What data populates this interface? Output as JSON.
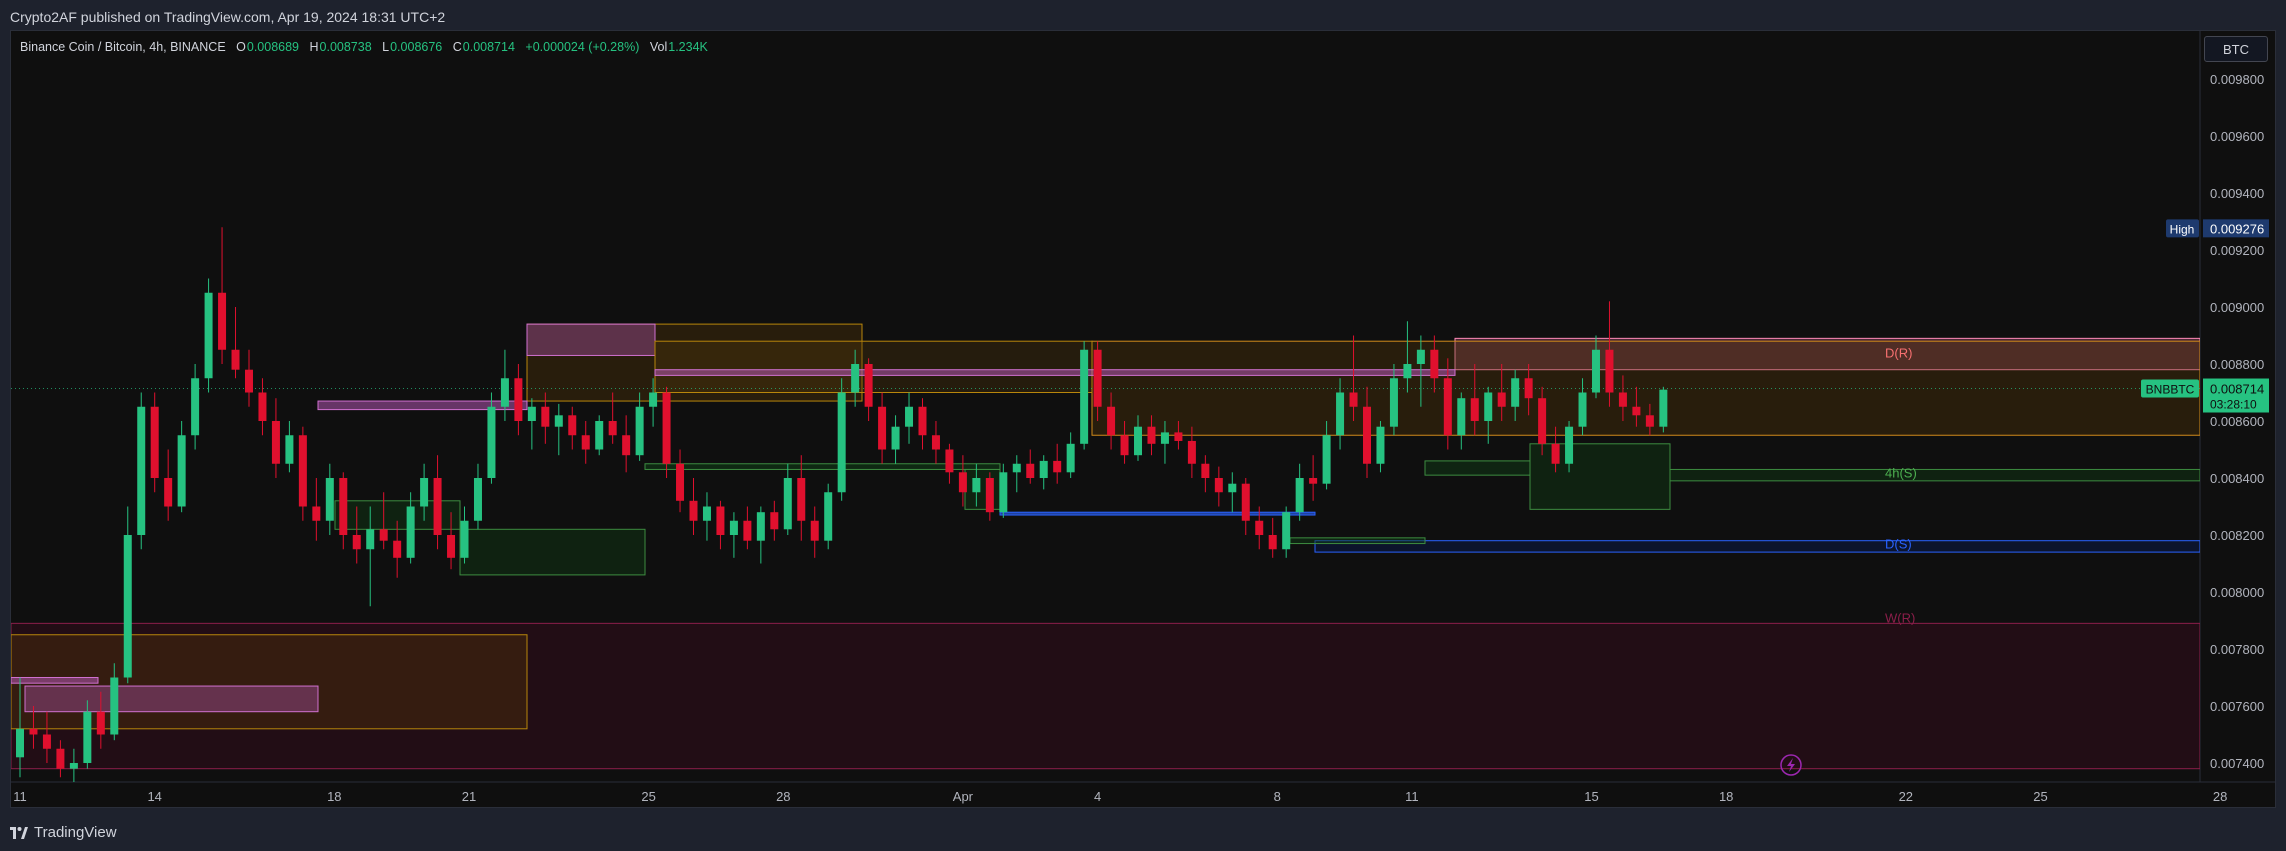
{
  "header": {
    "publish_text": "Crypto2AF published on TradingView.com, Apr 19, 2024 18:31 UTC+2",
    "symbol_text": "Binance Coin / Bitcoin, 4h, BINANCE",
    "o_label": "O",
    "o_value": "0.008689",
    "h_label": "H",
    "h_value": "0.008738",
    "l_label": "L",
    "l_value": "0.008676",
    "c_label": "C",
    "c_value": "0.008714",
    "change": "+0.000024 (+0.28%)",
    "vol_label": "Vol",
    "vol_value": "1.234K"
  },
  "toolbar": {
    "currency": "BTC"
  },
  "footer": {
    "brand": "TradingView"
  },
  "colors": {
    "up": "#26c281",
    "down": "#e0102e",
    "bg": "#0f0f0f"
  },
  "chart_data": {
    "type": "candlestick",
    "symbol": "BNBBTC",
    "timeframe": "4h",
    "ylim": [
      0.00734,
      0.00994
    ],
    "y_ticks": [
      "0.009800",
      "0.009600",
      "0.009400",
      "0.009200",
      "0.009000",
      "0.008800",
      "0.008600",
      "0.008400",
      "0.008200",
      "0.008000",
      "0.007800",
      "0.007600",
      "0.007400"
    ],
    "x_ticks": [
      "11",
      "14",
      "18",
      "21",
      "25",
      "28",
      "Apr",
      "4",
      "8",
      "11",
      "15",
      "18",
      "22",
      "25",
      "28"
    ],
    "high_label": "High",
    "high_value": "0.009276",
    "last_label": "BNBBTC",
    "last_price": "0.008714",
    "countdown": "03:28:10",
    "zones": [
      {
        "label": "D(R)",
        "from": 0.00878,
        "to": 0.00889,
        "color": "#ff6fa8"
      },
      {
        "label": "4h(S)",
        "from": 0.00839,
        "to": 0.00843,
        "color": "#4caf50"
      },
      {
        "label": "D(S)",
        "from": 0.00814,
        "to": 0.00818,
        "color": "#2962ff"
      },
      {
        "label": "W(R)",
        "from": 0.00738,
        "to": 0.00789,
        "color": "#8b1e4a"
      }
    ],
    "series": [
      {
        "name": "BNBBTC",
        "days": [
          [
            11,
            0.00742,
            0.0077,
            0.00735,
            0.00752
          ],
          [
            11.3,
            0.00752,
            0.0076,
            0.00745,
            0.0075
          ],
          [
            11.6,
            0.0075,
            0.00758,
            0.0074,
            0.00745
          ],
          [
            11.9,
            0.00745,
            0.00748,
            0.00735,
            0.00738
          ],
          [
            12.2,
            0.00738,
            0.00745,
            0.0073,
            0.0074
          ],
          [
            12.5,
            0.0074,
            0.00762,
            0.00738,
            0.00758
          ],
          [
            12.8,
            0.00758,
            0.00765,
            0.00745,
            0.0075
          ],
          [
            13.1,
            0.0075,
            0.00775,
            0.00748,
            0.0077
          ],
          [
            13.4,
            0.0077,
            0.0083,
            0.00768,
            0.0082
          ],
          [
            13.7,
            0.0082,
            0.0087,
            0.00815,
            0.00865
          ],
          [
            14,
            0.00865,
            0.0087,
            0.00835,
            0.0084
          ],
          [
            14.3,
            0.0084,
            0.0085,
            0.00825,
            0.0083
          ],
          [
            14.6,
            0.0083,
            0.0086,
            0.00828,
            0.00855
          ],
          [
            14.9,
            0.00855,
            0.0088,
            0.0085,
            0.00875
          ],
          [
            15.2,
            0.00875,
            0.0091,
            0.0087,
            0.00905
          ],
          [
            15.5,
            0.00905,
            0.00928,
            0.0088,
            0.00885
          ],
          [
            15.8,
            0.00885,
            0.009,
            0.00875,
            0.00878
          ],
          [
            16.1,
            0.00878,
            0.00885,
            0.00865,
            0.0087
          ],
          [
            16.4,
            0.0087,
            0.00875,
            0.00855,
            0.0086
          ],
          [
            16.7,
            0.0086,
            0.00868,
            0.0084,
            0.00845
          ],
          [
            17,
            0.00845,
            0.0086,
            0.00842,
            0.00855
          ],
          [
            17.3,
            0.00855,
            0.00858,
            0.00825,
            0.0083
          ],
          [
            17.6,
            0.0083,
            0.0084,
            0.00818,
            0.00825
          ],
          [
            17.9,
            0.00825,
            0.00845,
            0.0082,
            0.0084
          ],
          [
            18.2,
            0.0084,
            0.00842,
            0.00815,
            0.0082
          ],
          [
            18.5,
            0.0082,
            0.0083,
            0.0081,
            0.00815
          ],
          [
            18.8,
            0.00815,
            0.0083,
            0.00795,
            0.00822
          ],
          [
            19.1,
            0.00822,
            0.00835,
            0.00815,
            0.00818
          ],
          [
            19.4,
            0.00818,
            0.00825,
            0.00805,
            0.00812
          ],
          [
            19.7,
            0.00812,
            0.00835,
            0.0081,
            0.0083
          ],
          [
            20,
            0.0083,
            0.00845,
            0.00825,
            0.0084
          ],
          [
            20.3,
            0.0084,
            0.00848,
            0.00815,
            0.0082
          ],
          [
            20.6,
            0.0082,
            0.00828,
            0.00808,
            0.00812
          ],
          [
            20.9,
            0.00812,
            0.0083,
            0.0081,
            0.00825
          ],
          [
            21.2,
            0.00825,
            0.00845,
            0.00822,
            0.0084
          ],
          [
            21.5,
            0.0084,
            0.0087,
            0.00838,
            0.00865
          ],
          [
            21.8,
            0.00865,
            0.00885,
            0.0086,
            0.00875
          ],
          [
            22.1,
            0.00875,
            0.0088,
            0.00855,
            0.0086
          ],
          [
            22.4,
            0.0086,
            0.00868,
            0.0085,
            0.00865
          ],
          [
            22.7,
            0.00865,
            0.0087,
            0.00852,
            0.00858
          ],
          [
            23,
            0.00858,
            0.00866,
            0.00848,
            0.00862
          ],
          [
            23.3,
            0.00862,
            0.00865,
            0.0085,
            0.00855
          ],
          [
            23.6,
            0.00855,
            0.0086,
            0.00845,
            0.0085
          ],
          [
            23.9,
            0.0085,
            0.00862,
            0.00848,
            0.0086
          ],
          [
            24.2,
            0.0086,
            0.0087,
            0.00852,
            0.00855
          ],
          [
            24.5,
            0.00855,
            0.00862,
            0.00842,
            0.00848
          ],
          [
            24.8,
            0.00848,
            0.0087,
            0.00846,
            0.00865
          ],
          [
            25.1,
            0.00865,
            0.00875,
            0.00858,
            0.0087
          ],
          [
            25.4,
            0.0087,
            0.00872,
            0.0084,
            0.00845
          ],
          [
            25.7,
            0.00845,
            0.0085,
            0.00828,
            0.00832
          ],
          [
            26,
            0.00832,
            0.0084,
            0.0082,
            0.00825
          ],
          [
            26.3,
            0.00825,
            0.00835,
            0.00818,
            0.0083
          ],
          [
            26.6,
            0.0083,
            0.00832,
            0.00815,
            0.0082
          ],
          [
            26.9,
            0.0082,
            0.00828,
            0.00812,
            0.00825
          ],
          [
            27.2,
            0.00825,
            0.0083,
            0.00815,
            0.00818
          ],
          [
            27.5,
            0.00818,
            0.0083,
            0.0081,
            0.00828
          ],
          [
            27.8,
            0.00828,
            0.00832,
            0.00818,
            0.00822
          ],
          [
            28.1,
            0.00822,
            0.00845,
            0.0082,
            0.0084
          ],
          [
            28.4,
            0.0084,
            0.00848,
            0.00818,
            0.00825
          ],
          [
            28.7,
            0.00825,
            0.0083,
            0.00812,
            0.00818
          ],
          [
            29,
            0.00818,
            0.00838,
            0.00815,
            0.00835
          ],
          [
            29.3,
            0.00835,
            0.00875,
            0.00832,
            0.0087
          ],
          [
            29.6,
            0.0087,
            0.00885,
            0.00865,
            0.0088
          ],
          [
            29.9,
            0.0088,
            0.00882,
            0.0086,
            0.00865
          ],
          [
            30.2,
            0.00865,
            0.0087,
            0.00845,
            0.0085
          ],
          [
            30.5,
            0.0085,
            0.00862,
            0.00845,
            0.00858
          ],
          [
            30.8,
            0.00858,
            0.0087,
            0.00852,
            0.00865
          ],
          [
            31.1,
            0.00865,
            0.00868,
            0.0085,
            0.00855
          ],
          [
            31.4,
            0.00855,
            0.0086,
            0.00845,
            0.0085
          ],
          [
            31.7,
            0.0085,
            0.00852,
            0.00838,
            0.00842
          ],
          [
            32,
            0.00842,
            0.00848,
            0.0083,
            0.00835
          ],
          [
            32.3,
            0.00835,
            0.00845,
            0.0083,
            0.0084
          ],
          [
            32.6,
            0.0084,
            0.00842,
            0.00825,
            0.00828
          ],
          [
            32.9,
            0.00828,
            0.00845,
            0.00826,
            0.00842
          ],
          [
            33.2,
            0.00842,
            0.00848,
            0.00835,
            0.00845
          ],
          [
            33.5,
            0.00845,
            0.0085,
            0.00838,
            0.0084
          ],
          [
            33.8,
            0.0084,
            0.00848,
            0.00836,
            0.00846
          ],
          [
            34.1,
            0.00846,
            0.00852,
            0.00838,
            0.00842
          ],
          [
            34.4,
            0.00842,
            0.00856,
            0.0084,
            0.00852
          ],
          [
            34.7,
            0.00852,
            0.00888,
            0.0085,
            0.00885
          ],
          [
            35,
            0.00885,
            0.00888,
            0.0086,
            0.00865
          ],
          [
            35.3,
            0.00865,
            0.0087,
            0.0085,
            0.00855
          ],
          [
            35.6,
            0.00855,
            0.0086,
            0.00845,
            0.00848
          ],
          [
            35.9,
            0.00848,
            0.00862,
            0.00846,
            0.00858
          ],
          [
            36.2,
            0.00858,
            0.00862,
            0.00848,
            0.00852
          ],
          [
            36.5,
            0.00852,
            0.0086,
            0.00845,
            0.00856
          ],
          [
            36.8,
            0.00856,
            0.0086,
            0.0085,
            0.00853
          ],
          [
            37.1,
            0.00853,
            0.00858,
            0.0084,
            0.00845
          ],
          [
            37.4,
            0.00845,
            0.00848,
            0.00835,
            0.0084
          ],
          [
            37.7,
            0.0084,
            0.00844,
            0.0083,
            0.00835
          ],
          [
            38,
            0.00835,
            0.00842,
            0.00828,
            0.00838
          ],
          [
            38.3,
            0.00838,
            0.0084,
            0.0082,
            0.00825
          ],
          [
            38.6,
            0.00825,
            0.0083,
            0.00815,
            0.0082
          ],
          [
            38.9,
            0.0082,
            0.00826,
            0.00812,
            0.00815
          ],
          [
            39.2,
            0.00815,
            0.0083,
            0.00812,
            0.00828
          ],
          [
            39.5,
            0.00828,
            0.00845,
            0.00825,
            0.0084
          ],
          [
            39.8,
            0.0084,
            0.00848,
            0.00832,
            0.00838
          ],
          [
            40.1,
            0.00838,
            0.0086,
            0.00836,
            0.00855
          ],
          [
            40.4,
            0.00855,
            0.00875,
            0.0085,
            0.0087
          ],
          [
            40.7,
            0.0087,
            0.0089,
            0.0086,
            0.00865
          ],
          [
            41,
            0.00865,
            0.00872,
            0.0084,
            0.00845
          ],
          [
            41.3,
            0.00845,
            0.0086,
            0.00842,
            0.00858
          ],
          [
            41.6,
            0.00858,
            0.0088,
            0.00855,
            0.00875
          ],
          [
            41.9,
            0.00875,
            0.00895,
            0.0087,
            0.0088
          ],
          [
            42.2,
            0.0088,
            0.0089,
            0.00865,
            0.00885
          ],
          [
            42.5,
            0.00885,
            0.0089,
            0.0087,
            0.00875
          ],
          [
            42.8,
            0.00875,
            0.00882,
            0.0085,
            0.00855
          ],
          [
            43.1,
            0.00855,
            0.0087,
            0.0085,
            0.00868
          ],
          [
            43.4,
            0.00868,
            0.0088,
            0.00855,
            0.0086
          ],
          [
            43.7,
            0.0086,
            0.00872,
            0.00852,
            0.0087
          ],
          [
            44,
            0.0087,
            0.0088,
            0.0086,
            0.00865
          ],
          [
            44.3,
            0.00865,
            0.00878,
            0.0086,
            0.00875
          ],
          [
            44.6,
            0.00875,
            0.0088,
            0.00862,
            0.00868
          ],
          [
            44.9,
            0.00868,
            0.00872,
            0.00848,
            0.00852
          ],
          [
            45.2,
            0.00852,
            0.00858,
            0.00842,
            0.00845
          ],
          [
            45.5,
            0.00845,
            0.0086,
            0.00842,
            0.00858
          ],
          [
            45.8,
            0.00858,
            0.00875,
            0.00855,
            0.0087
          ],
          [
            46.1,
            0.0087,
            0.0089,
            0.00868,
            0.00885
          ],
          [
            46.4,
            0.00885,
            0.00902,
            0.00865,
            0.0087
          ],
          [
            46.7,
            0.0087,
            0.00876,
            0.0086,
            0.00865
          ],
          [
            47,
            0.00865,
            0.00872,
            0.00858,
            0.00862
          ],
          [
            47.3,
            0.00862,
            0.00866,
            0.00855,
            0.00858
          ],
          [
            47.6,
            0.00858,
            0.00872,
            0.00856,
            0.00871
          ]
        ]
      }
    ]
  }
}
